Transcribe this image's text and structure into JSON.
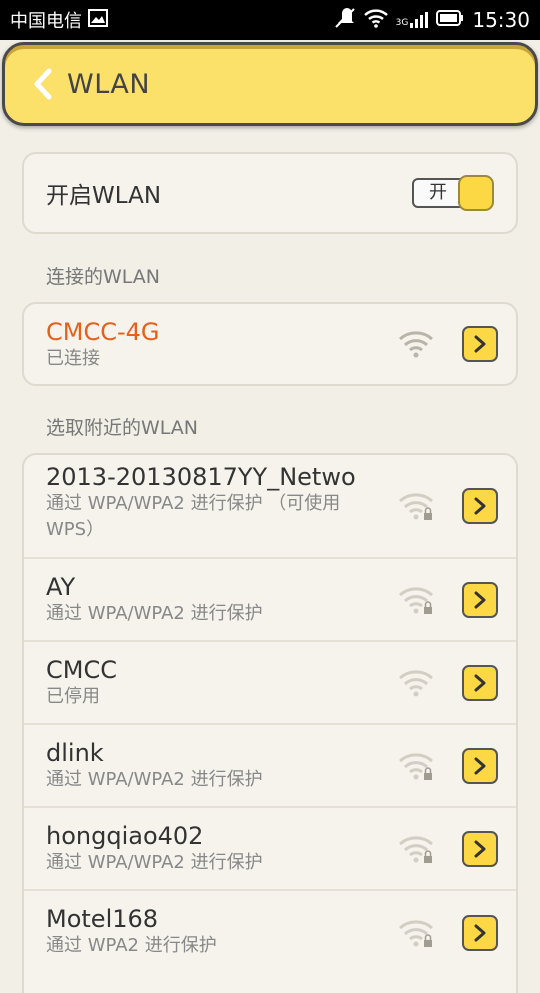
{
  "status_bar": {
    "carrier": "中国电信",
    "network": "3G",
    "time": "15:30"
  },
  "header": {
    "title": "WLAN"
  },
  "wlan_toggle": {
    "label": "开启WLAN",
    "state_text": "开"
  },
  "sections": {
    "connected_header": "连接的WLAN",
    "nearby_header": "选取附近的WLAN"
  },
  "connected": {
    "name": "CMCC-4G",
    "status": "已连接"
  },
  "networks": [
    {
      "name": "2013-20130817YY_Netwo",
      "status": "通过 WPA/WPA2 进行保护 （可使用 WPS）",
      "secured": true
    },
    {
      "name": "AY",
      "status": "通过 WPA/WPA2 进行保护",
      "secured": true
    },
    {
      "name": "CMCC",
      "status": "已停用",
      "secured": false
    },
    {
      "name": "dlink",
      "status": "通过 WPA/WPA2 进行保护",
      "secured": true
    },
    {
      "name": "hongqiao402",
      "status": "通过 WPA/WPA2 进行保护",
      "secured": true
    },
    {
      "name": "Motel168",
      "status": "通过 WPA2 进行保护",
      "secured": true
    }
  ],
  "colors": {
    "accent_yellow": "#fcd844",
    "connected_orange": "#e5601a"
  }
}
